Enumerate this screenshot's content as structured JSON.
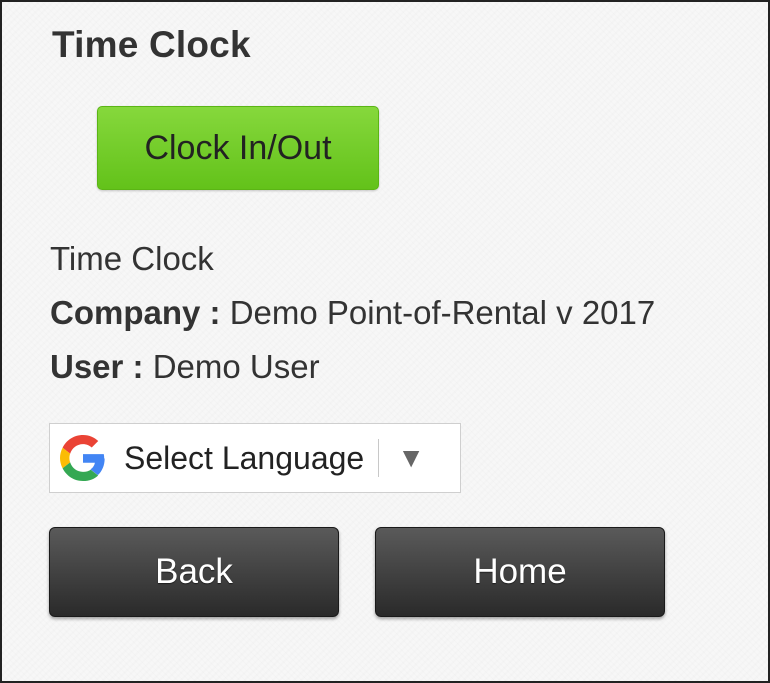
{
  "header": {
    "title": "Time Clock"
  },
  "actions": {
    "clock_label": "Clock In/Out"
  },
  "info": {
    "section_label": "Time Clock",
    "company_label": "Company :",
    "company_value": "Demo Point-of-Rental v 2017",
    "user_label": "User :",
    "user_value": "Demo User"
  },
  "language": {
    "label": "Select Language",
    "icon": "google-g-icon",
    "arrow": "▼"
  },
  "nav": {
    "back_label": "Back",
    "home_label": "Home"
  },
  "colors": {
    "accent_green": "#6cc926",
    "nav_dark": "#2f2f2f",
    "text": "#333333"
  }
}
